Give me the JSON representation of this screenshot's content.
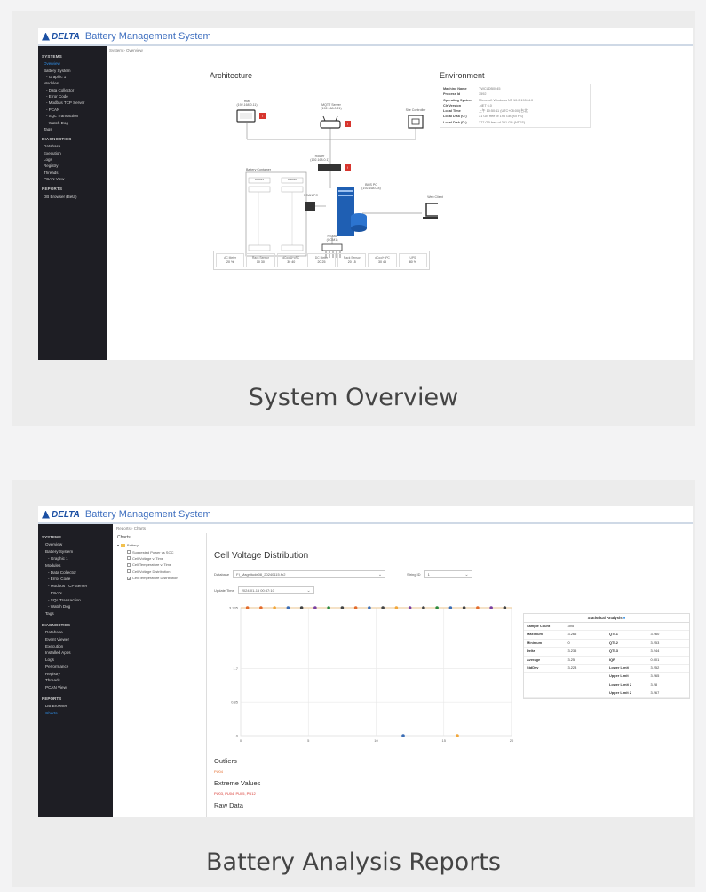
{
  "app": {
    "logo": "DELTA",
    "title": "Battery Management System"
  },
  "overview": {
    "caption": "System Overview",
    "breadcrumb": "System  ›  Overview",
    "sidebar": [
      {
        "label": "SYSTEMS",
        "type": "sec"
      },
      {
        "label": "Overview",
        "type": "it",
        "active": true
      },
      {
        "label": "Battery System",
        "type": "it"
      },
      {
        "label": "- Graphic 1",
        "type": "sub"
      },
      {
        "label": "Modules",
        "type": "it"
      },
      {
        "label": "- Data Collector",
        "type": "sub"
      },
      {
        "label": "- Error Code",
        "type": "sub"
      },
      {
        "label": "- Modbus TCP Server",
        "type": "sub"
      },
      {
        "label": "- PCAN",
        "type": "sub"
      },
      {
        "label": "- SQL Transaction",
        "type": "sub"
      },
      {
        "label": "- Watch Dog",
        "type": "sub"
      },
      {
        "label": "Tags",
        "type": "it"
      },
      {
        "label": "DIAGNOSTICS",
        "type": "sec"
      },
      {
        "label": "Database",
        "type": "it"
      },
      {
        "label": "Execution",
        "type": "it"
      },
      {
        "label": "Logs",
        "type": "it"
      },
      {
        "label": "Registry",
        "type": "it"
      },
      {
        "label": "Threads",
        "type": "it"
      },
      {
        "label": "PCAN View",
        "type": "it"
      },
      {
        "label": "REPORTS",
        "type": "sec"
      },
      {
        "label": "DB Browser (Beta)",
        "type": "it"
      }
    ],
    "architecture_title": "Architecture",
    "environment_title": "Environment",
    "environment": [
      {
        "k": "Machine Name",
        "v": "TWCLDB0045"
      },
      {
        "k": "Process Id",
        "v": "3592"
      },
      {
        "k": "Operating System",
        "v": "Microsoft Windows NT 10.0.19044.0"
      },
      {
        "k": "Clr Version",
        "v": ".NET 6.0"
      },
      {
        "k": "Local Time",
        "v": "上午 10:50:11 (UTC+08:00) 台北"
      },
      {
        "k": "Local Disk (C:)",
        "v": "31 GB free of 195 GB (NTFS)"
      },
      {
        "k": "Local Disk (D:)",
        "v": "377 GB free of 391 GB (NTFS)"
      }
    ],
    "nodes": {
      "hmi": "HMI\n(192.168.0.11)",
      "mqtt": "MQTT Server\n(192.168.0.21)",
      "site": "Site Controller",
      "router": "Router\n(192.168.0.1)",
      "bms": "BMS PC\n(192.168.0.8)",
      "container": "Battery Container",
      "pcan": "PCAN PC",
      "client": "Web Client",
      "rs485": "RS485\n(COM1)",
      "rack1": "Rack#1",
      "rack2": "Rack#2"
    },
    "strip": [
      {
        "label": "AC Meter",
        "value": "20 %"
      },
      {
        "label": "Rack Sensor",
        "value": "10 30"
      },
      {
        "label": "dCoolA+cPC",
        "value": "30 40"
      },
      {
        "label": "DC Meter",
        "value": "20 25"
      },
      {
        "label": "Rack Sensor",
        "value": "20 15"
      },
      {
        "label": "dCool+cPC",
        "value": "30 45"
      },
      {
        "label": "UPS",
        "value": "80 %"
      }
    ]
  },
  "reports": {
    "caption": "Battery Analysis Reports",
    "breadcrumb": "Reports  ›  Charts",
    "sidebar": [
      {
        "label": "SYSTEMS",
        "type": "sec"
      },
      {
        "label": "Overview",
        "type": "it"
      },
      {
        "label": "Battery System",
        "type": "it"
      },
      {
        "label": "- Graphic 1",
        "type": "sub"
      },
      {
        "label": "Modules",
        "type": "it"
      },
      {
        "label": "- Data Collector",
        "type": "sub"
      },
      {
        "label": "- Error Code",
        "type": "sub"
      },
      {
        "label": "- Modbus TCP Server",
        "type": "sub"
      },
      {
        "label": "- PCAN",
        "type": "sub"
      },
      {
        "label": "- SQL Transaction",
        "type": "sub"
      },
      {
        "label": "- Watch Dog",
        "type": "sub"
      },
      {
        "label": "Tags",
        "type": "it"
      },
      {
        "label": "DIAGNOSTICS",
        "type": "sec"
      },
      {
        "label": "Database",
        "type": "it"
      },
      {
        "label": "Event Viewer",
        "type": "it"
      },
      {
        "label": "Execution",
        "type": "it"
      },
      {
        "label": "Installed Apps",
        "type": "it"
      },
      {
        "label": "Logs",
        "type": "it"
      },
      {
        "label": "Performance",
        "type": "it"
      },
      {
        "label": "Registry",
        "type": "it"
      },
      {
        "label": "Threads",
        "type": "it"
      },
      {
        "label": "PCAN View",
        "type": "it"
      },
      {
        "label": "REPORTS",
        "type": "sec"
      },
      {
        "label": "DB Browser",
        "type": "it"
      },
      {
        "label": "Charts",
        "type": "it",
        "active": true
      }
    ],
    "tree_header": "Charts",
    "tree_root": "Battery",
    "tree_items": [
      {
        "label": "Suggested Power vs SOC",
        "checked": false
      },
      {
        "label": "Cell Voltage v. Time",
        "checked": false
      },
      {
        "label": "Cell Temperature v. Time",
        "checked": false
      },
      {
        "label": "Cell Voltage Distribution",
        "checked": false
      },
      {
        "label": "Cell Temperature Distribution",
        "checked": true
      }
    ],
    "title": "Cell Voltage Distribution",
    "database_label": "Database",
    "database_value": "FI_Magnitude08_20240115.fb2",
    "string_label": "String ID",
    "string_value": "1",
    "update_label": "Update Time",
    "update_value": "2024-01-15 00:57:10",
    "outliers_title": "Outliers",
    "outliers_value": "PU04",
    "extreme_title": "Extreme Values",
    "extreme_value": "PU03, PU04, PU05, PU12",
    "raw_title": "Raw Data",
    "stats_title": "Statistical Analysis",
    "stats": [
      [
        "Sample Count",
        "395",
        "",
        ""
      ],
      [
        "Maximum",
        "3.265",
        "QTL1",
        "3.260"
      ],
      [
        "Minimum",
        "0",
        "QTL2",
        "3.253"
      ],
      [
        "Delta",
        "3.235",
        "QTL3",
        "3.244"
      ],
      [
        "Average",
        "3.25",
        "IQR",
        "0.001"
      ],
      [
        "StdDev",
        "3.223",
        "Lower Limit",
        "3.252"
      ],
      [
        "",
        "",
        "Upper Limit",
        "3.265"
      ],
      [
        "",
        "",
        "Lower Limit 2",
        "3.28"
      ],
      [
        "",
        "",
        "Upper Limit 2",
        "3.267"
      ]
    ],
    "chart_data": {
      "type": "scatter",
      "yticks": [
        "3.235",
        "1.7",
        "0.85",
        "0"
      ],
      "xticks": [
        "0",
        "5",
        "10",
        "15",
        "20"
      ],
      "ylim": [
        0,
        3.235
      ],
      "xlim": [
        0,
        20
      ],
      "points_top": [
        {
          "x": 0.5,
          "y": 3.235,
          "c": "#e36b2b"
        },
        {
          "x": 1.5,
          "y": 3.235,
          "c": "#e36b2b"
        },
        {
          "x": 2.5,
          "y": 3.235,
          "c": "#f2a73a"
        },
        {
          "x": 3.5,
          "y": 3.235,
          "c": "#3b6db5"
        },
        {
          "x": 4.5,
          "y": 3.235,
          "c": "#444"
        },
        {
          "x": 5.5,
          "y": 3.235,
          "c": "#7a3fa0"
        },
        {
          "x": 6.5,
          "y": 3.235,
          "c": "#2b8a3e"
        },
        {
          "x": 7.5,
          "y": 3.235,
          "c": "#444"
        },
        {
          "x": 8.5,
          "y": 3.235,
          "c": "#e36b2b"
        },
        {
          "x": 9.5,
          "y": 3.235,
          "c": "#3b6db5"
        },
        {
          "x": 10.5,
          "y": 3.235,
          "c": "#444"
        },
        {
          "x": 11.5,
          "y": 3.235,
          "c": "#f2a73a"
        },
        {
          "x": 12.5,
          "y": 3.235,
          "c": "#7a3fa0"
        },
        {
          "x": 13.5,
          "y": 3.235,
          "c": "#444"
        },
        {
          "x": 14.5,
          "y": 3.235,
          "c": "#2b8a3e"
        },
        {
          "x": 15.5,
          "y": 3.235,
          "c": "#3b6db5"
        },
        {
          "x": 16.5,
          "y": 3.235,
          "c": "#444"
        },
        {
          "x": 17.5,
          "y": 3.235,
          "c": "#e36b2b"
        },
        {
          "x": 18.5,
          "y": 3.235,
          "c": "#7a3fa0"
        },
        {
          "x": 19.5,
          "y": 3.235,
          "c": "#444"
        }
      ],
      "points_bottom": [
        {
          "x": 12,
          "y": 0,
          "c": "#3b6db5"
        },
        {
          "x": 16,
          "y": 0,
          "c": "#f2a73a"
        }
      ]
    }
  }
}
